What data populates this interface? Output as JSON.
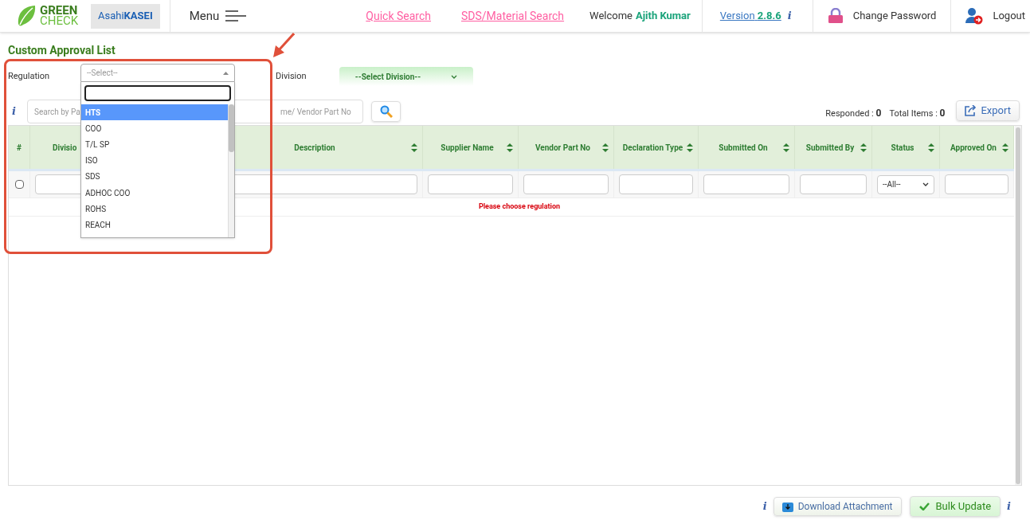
{
  "header": {
    "brand_top": "GREEN",
    "brand_bottom": "CHECK",
    "partner_light": "Asahi",
    "partner_bold": "KASEI",
    "menu": "Menu",
    "links": [
      "Quick Search",
      "SDS/Material Search"
    ],
    "welcome": "Welcome",
    "user": "Ajith Kumar",
    "version_label": "Version",
    "version": "2.8.6",
    "info": "i",
    "change_password": "Change Password",
    "logout": "Logout"
  },
  "page_title": "Custom Approval List",
  "filters": {
    "regulation_label": "Regulation",
    "regulation_placeholder": "--Select--",
    "division_label": "Division",
    "division_value": "--Select Division--"
  },
  "regulation_dropdown": {
    "expanded": true,
    "options": [
      {
        "label": "HTS",
        "selected": true
      },
      {
        "label": "COO",
        "selected": false
      },
      {
        "label": "T/L SP",
        "selected": false
      },
      {
        "label": "ISO",
        "selected": false
      },
      {
        "label": "SDS",
        "selected": false
      },
      {
        "label": "ADHOC COO",
        "selected": false
      },
      {
        "label": "ROHS",
        "selected": false
      },
      {
        "label": "REACH",
        "selected": false
      }
    ]
  },
  "search": {
    "info": "i",
    "placeholder_start": "Search by Pa",
    "placeholder_end": "me/ Vendor Part No"
  },
  "counts": {
    "responded_label": "Responded :",
    "responded": "0",
    "total_label": "Total Items :",
    "total": "0"
  },
  "export": "Export",
  "table": {
    "columns": [
      {
        "label": "#",
        "sortable": false
      },
      {
        "label": "Divisio",
        "sortable": false
      },
      {
        "label": "Description",
        "sortable": true
      },
      {
        "label": "Supplier Name",
        "sortable": true
      },
      {
        "label": "Vendor Part No",
        "sortable": true
      },
      {
        "label": "Declaration Type",
        "sortable": true
      },
      {
        "label": "Submitted On",
        "sortable": true
      },
      {
        "label": "Submitted By",
        "sortable": true
      },
      {
        "label": "Status",
        "sortable": true
      },
      {
        "label": "Approved On",
        "sortable": true
      }
    ],
    "select_all_checked": false,
    "status_filter": "--All--",
    "message": "Please choose regulation"
  },
  "footer": {
    "info_left": "i",
    "info_right": "i",
    "download": "Download Attachment",
    "bulk_update": "Bulk Update"
  }
}
